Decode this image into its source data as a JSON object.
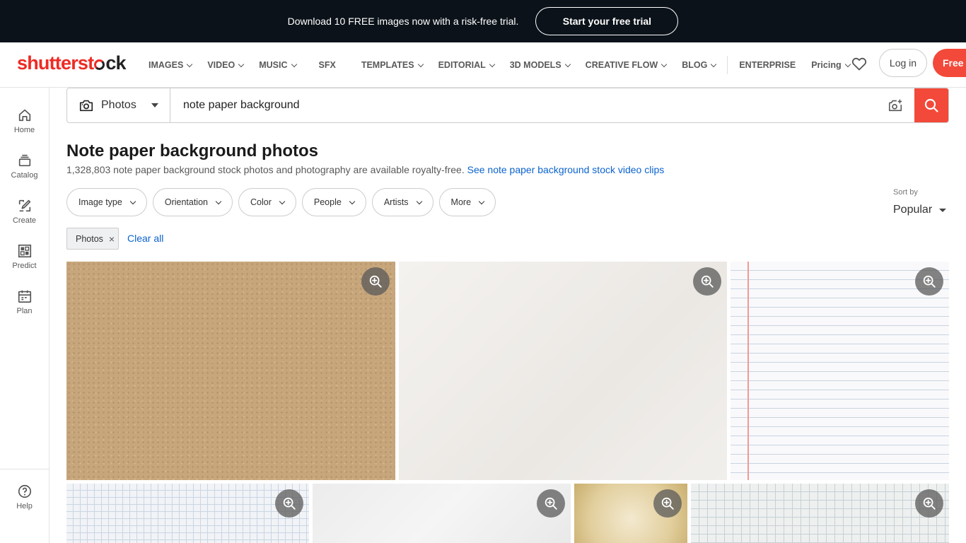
{
  "promo": {
    "text": "Download 10 FREE images now with a risk-free trial.",
    "button": "Start your free trial"
  },
  "brand": {
    "logo_pre": "shutterst",
    "logo_post": "ck",
    "accent": "#f3493a"
  },
  "nav": {
    "items": [
      {
        "label": "IMAGES",
        "dropdown": true
      },
      {
        "label": "VIDEO",
        "dropdown": true
      },
      {
        "label": "MUSIC",
        "dropdown": true
      },
      {
        "label": "SFX",
        "dropdown": false
      },
      {
        "label": "TEMPLATES",
        "dropdown": true
      },
      {
        "label": "EDITORIAL",
        "dropdown": true
      },
      {
        "label": "3D MODELS",
        "dropdown": true
      },
      {
        "label": "CREATIVE FLOW",
        "dropdown": true
      },
      {
        "label": "BLOG",
        "dropdown": true
      }
    ],
    "enterprise": "ENTERPRISE",
    "pricing": "Pricing",
    "login": "Log in",
    "free": "Free t"
  },
  "sidebar": {
    "items": [
      {
        "label": "Home",
        "icon": "home-icon"
      },
      {
        "label": "Catalog",
        "icon": "catalog-icon"
      },
      {
        "label": "Create",
        "icon": "create-icon"
      },
      {
        "label": "Predict",
        "icon": "predict-icon"
      },
      {
        "label": "Plan",
        "icon": "plan-icon"
      }
    ],
    "help": "Help"
  },
  "search": {
    "type": "Photos",
    "query": "note paper background"
  },
  "results": {
    "title": "Note paper background photos",
    "count_text": "1,328,803 note paper background stock photos and photography are available royalty-free.",
    "video_link": "See note paper background stock video clips"
  },
  "filters": [
    "Image type",
    "Orientation",
    "Color",
    "People",
    "Artists",
    "More"
  ],
  "sort": {
    "label": "Sort by",
    "value": "Popular"
  },
  "applied": {
    "chip": "Photos",
    "clear": "Clear all"
  }
}
